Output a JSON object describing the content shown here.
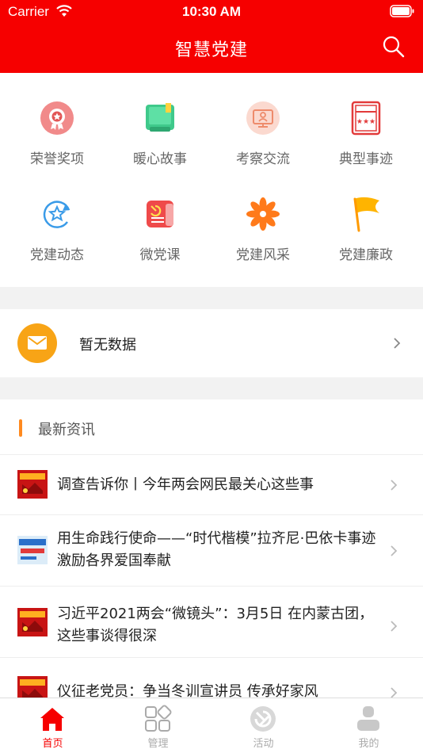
{
  "status": {
    "carrier": "Carrier",
    "time": "10:30 AM"
  },
  "header": {
    "title": "智慧党建"
  },
  "grid": [
    {
      "label": "荣誉奖项",
      "icon": "medal-icon"
    },
    {
      "label": "暖心故事",
      "icon": "book-icon"
    },
    {
      "label": "考察交流",
      "icon": "monitor-person-icon"
    },
    {
      "label": "典型事迹",
      "icon": "certificate-icon"
    },
    {
      "label": "党建动态",
      "icon": "refresh-star-icon"
    },
    {
      "label": "微党课",
      "icon": "party-scroll-icon"
    },
    {
      "label": "党建风采",
      "icon": "flower-icon"
    },
    {
      "label": "党建廉政",
      "icon": "flag-icon"
    }
  ],
  "notice": {
    "text": "暂无数据"
  },
  "news": {
    "section_title": "最新资讯",
    "items": [
      {
        "title": "调查告诉你丨今年两会网民最关心这些事"
      },
      {
        "title": "用生命践行使命——“时代楷模”拉齐尼·巴依卡事迹激励各界爱国奉献"
      },
      {
        "title": "习近平2021两会“微镜头”：3月5日 在内蒙古团，这些事谈得很深"
      },
      {
        "title": "仪征老党员：争当冬训宣讲员 传承好家风"
      }
    ]
  },
  "tabs": [
    {
      "label": "首页",
      "active": true
    },
    {
      "label": "管理",
      "active": false
    },
    {
      "label": "活动",
      "active": false
    },
    {
      "label": "我的",
      "active": false
    }
  ],
  "colors": {
    "primary": "#f60000",
    "accent": "#f8a416",
    "orange_bar": "#ff8a1f"
  }
}
